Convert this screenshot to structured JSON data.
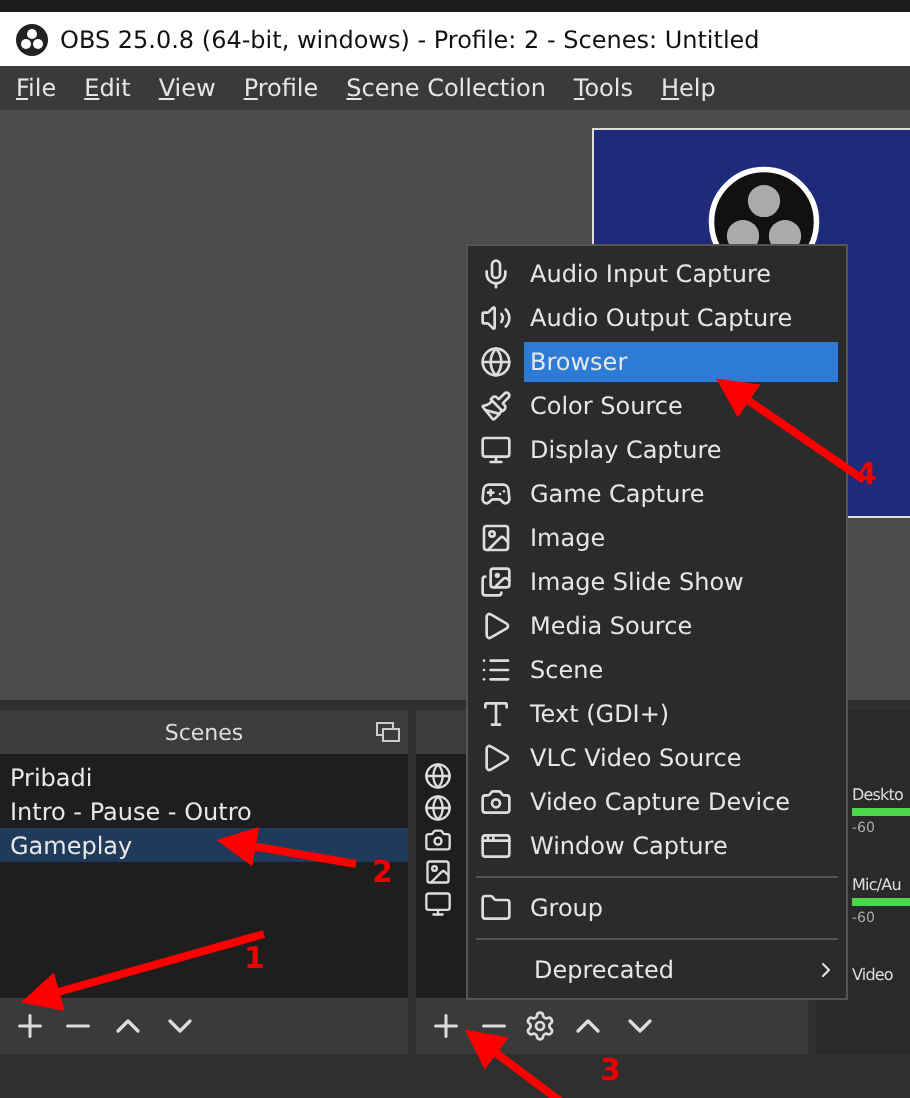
{
  "window": {
    "title": "OBS 25.0.8 (64-bit, windows) - Profile: 2 - Scenes: Untitled"
  },
  "menu_bar": [
    {
      "label": "File"
    },
    {
      "label": "Edit"
    },
    {
      "label": "View"
    },
    {
      "label": "Profile"
    },
    {
      "label": "Scene Collection"
    },
    {
      "label": "Tools"
    },
    {
      "label": "Help"
    }
  ],
  "scenes": {
    "title": "Scenes",
    "items": [
      {
        "label": "Pribadi",
        "selected": false
      },
      {
        "label": "Intro - Pause - Outro",
        "selected": false
      },
      {
        "label": "Gameplay",
        "selected": true
      }
    ]
  },
  "audio_mixer": {
    "channels": [
      {
        "name": "Deskto",
        "tick": "-60"
      },
      {
        "name": "Mic/Au",
        "tick": "-60"
      },
      {
        "name": "Video"
      }
    ]
  },
  "add_source_menu": [
    {
      "kind": "item",
      "label": "Audio Input Capture",
      "selected": false
    },
    {
      "kind": "item",
      "label": "Audio Output Capture",
      "selected": false
    },
    {
      "kind": "item",
      "label": "Browser",
      "selected": true
    },
    {
      "kind": "item",
      "label": "Color Source",
      "selected": false
    },
    {
      "kind": "item",
      "label": "Display Capture",
      "selected": false
    },
    {
      "kind": "item",
      "label": "Game Capture",
      "selected": false
    },
    {
      "kind": "item",
      "label": "Image",
      "selected": false
    },
    {
      "kind": "item",
      "label": "Image Slide Show",
      "selected": false
    },
    {
      "kind": "item",
      "label": "Media Source",
      "selected": false
    },
    {
      "kind": "item",
      "label": "Scene",
      "selected": false
    },
    {
      "kind": "item",
      "label": "Text (GDI+)",
      "selected": false
    },
    {
      "kind": "item",
      "label": "VLC Video Source",
      "selected": false
    },
    {
      "kind": "item",
      "label": "Video Capture Device",
      "selected": false
    },
    {
      "kind": "item",
      "label": "Window Capture",
      "selected": false
    },
    {
      "kind": "separator"
    },
    {
      "kind": "item",
      "label": "Group",
      "selected": false
    },
    {
      "kind": "separator"
    },
    {
      "kind": "submenu",
      "label": "Deprecated",
      "selected": false
    }
  ],
  "annotations": [
    {
      "label": "1"
    },
    {
      "label": "2"
    },
    {
      "label": "3"
    },
    {
      "label": "4"
    }
  ]
}
